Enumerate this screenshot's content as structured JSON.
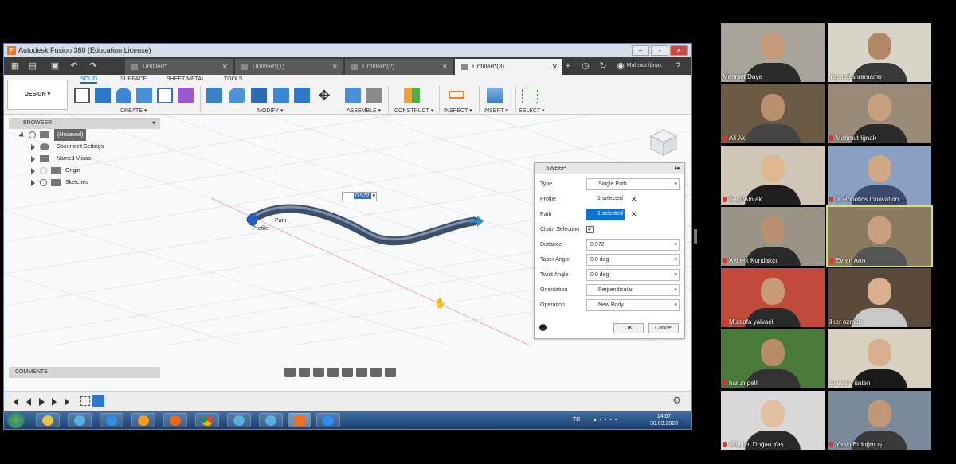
{
  "window": {
    "title": "Autodesk Fusion 360 (Education License)"
  },
  "doc_tabs": [
    {
      "label": "Untitled*",
      "active": false
    },
    {
      "label": "Untitled*(1)",
      "active": false
    },
    {
      "label": "Untitled*(2)",
      "active": false
    },
    {
      "label": "Untitled*(3)",
      "active": true
    }
  ],
  "user_name": "Mahmut İğnak",
  "workspace_button": "DESIGN ▾",
  "ribbon_tabs": [
    "SOLID",
    "SURFACE",
    "SHEET METAL",
    "TOOLS"
  ],
  "ribbon_groups": [
    "CREATE ▾",
    "MODIFY ▾",
    "ASSEMBLE ▾",
    "CONSTRUCT ▾",
    "INSPECT ▾",
    "INSERT ▾",
    "SELECT ▾"
  ],
  "browser": {
    "title": "BROWSER",
    "items": [
      "(Unsaved)",
      "Document Settings",
      "Named Views",
      "Origin",
      "Sketches"
    ]
  },
  "comments_label": "COMMENTS",
  "dimension_value": "0.972",
  "canvas_labels": {
    "profile": "Profile",
    "path": "Path"
  },
  "sweep": {
    "title": "SWEEP",
    "rows": [
      {
        "label": "Type",
        "value": "Single Path"
      },
      {
        "label": "Profile",
        "value": "1 selected"
      },
      {
        "label": "Path",
        "value": "1 selected"
      },
      {
        "label": "Chain Selection",
        "value": "✔"
      },
      {
        "label": "Distance",
        "value": "0.972"
      },
      {
        "label": "Taper Angle",
        "value": "0.0 deg"
      },
      {
        "label": "Twist Angle",
        "value": "0.0 deg"
      },
      {
        "label": "Orientation",
        "value": "Perpendicular"
      },
      {
        "label": "Operation",
        "value": "New Body"
      }
    ],
    "ok": "OK",
    "cancel": "Cancel"
  },
  "taskbar": {
    "language": "TR",
    "time": "14:07",
    "date": "30.03.2020"
  },
  "participants": [
    {
      "name": "Mehmet Daye",
      "muted": false
    },
    {
      "name": "Yaşar Kahramaner",
      "muted": false
    },
    {
      "name": "Ali Ak",
      "muted": true
    },
    {
      "name": "Mahmut İğnak",
      "muted": true
    },
    {
      "name": "Seçil Alnıak",
      "muted": true
    },
    {
      "name": "Jr Robotics Innovation...",
      "muted": true
    },
    {
      "name": "Ayberk Kundakçı",
      "muted": true
    },
    {
      "name": "Evren Arın",
      "muted": true
    },
    {
      "name": "Mustafa yalvaçlı",
      "muted": true
    },
    {
      "name": "ilker ozman",
      "muted": false
    },
    {
      "name": "harun pelit",
      "muted": true
    },
    {
      "name": "Şevval Yünten",
      "muted": false
    },
    {
      "name": "Gülsüm Doğan Yaş...",
      "muted": true
    },
    {
      "name": "Yasin Erdoğmuş",
      "muted": true
    }
  ],
  "colors": {
    "accent": "#0d74d1",
    "active_speaker": "#d6e26a",
    "mic_muted": "#dd3333"
  }
}
